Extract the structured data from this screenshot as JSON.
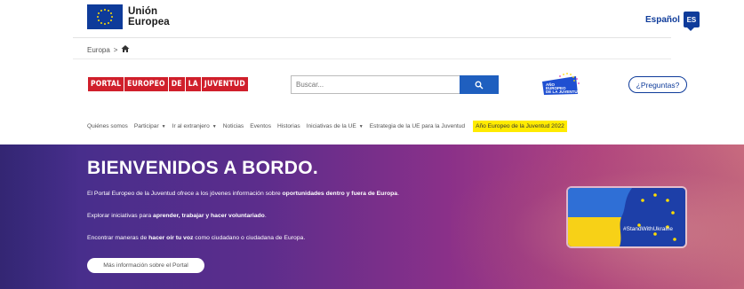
{
  "header": {
    "eu_name_line1": "Unión",
    "eu_name_line2": "Europea",
    "language_label": "Español",
    "language_code": "ES"
  },
  "breadcrumb": {
    "item1": "Europa",
    "separator": ">"
  },
  "portal_logo": {
    "words": [
      "PORTAL",
      "EUROPEO",
      "DE",
      "LA",
      "JUVENTUD"
    ]
  },
  "search": {
    "placeholder": "Buscar..."
  },
  "year_logo_text": "Año Europeo de la Juventud",
  "faq_button": "¿Preguntas?",
  "nav": {
    "items": [
      {
        "label": "Quiénes somos",
        "dropdown": false
      },
      {
        "label": "Participar",
        "dropdown": true
      },
      {
        "label": "Ir al extranjero",
        "dropdown": true
      },
      {
        "label": "Noticias",
        "dropdown": false
      },
      {
        "label": "Eventos",
        "dropdown": false
      },
      {
        "label": "Historias",
        "dropdown": false
      },
      {
        "label": "Iniciativas de la UE",
        "dropdown": true
      },
      {
        "label": "Estrategia de la UE para la Juventud",
        "dropdown": false
      }
    ],
    "highlight": "Año Europeo de la Juventud 2022"
  },
  "hero": {
    "title": "BIENVENIDOS A BORDO.",
    "line1_pre": "El Portal Europeo de la Juventud ofrece a los jóvenes información sobre ",
    "line1_bold": "oportunidades dentro y fuera de Europa",
    "line1_post": ".",
    "line2_pre": "Explorar iniciativas para ",
    "line2_bold": "aprender, trabajar y hacer voluntariado",
    "line2_post": ".",
    "line3_pre": "Encontrar maneras de ",
    "line3_bold": "hacer oír tu voz",
    "line3_post": " como ciudadano o ciudadana de Europa.",
    "button": "Más información sobre el Portal",
    "ukraine_tag": "#StandWithUkraine"
  },
  "colors": {
    "eu_blue": "#0e3b9a",
    "portal_red": "#d01f2b",
    "search_blue": "#1f5fbf",
    "highlight_yellow": "#ffeb00",
    "ukraine_blue": "#2f6fd6",
    "ukraine_yellow": "#f7d117"
  },
  "icons": {
    "home": "home-icon",
    "search": "search-icon",
    "eu_flag": "eu-flag-icon"
  }
}
